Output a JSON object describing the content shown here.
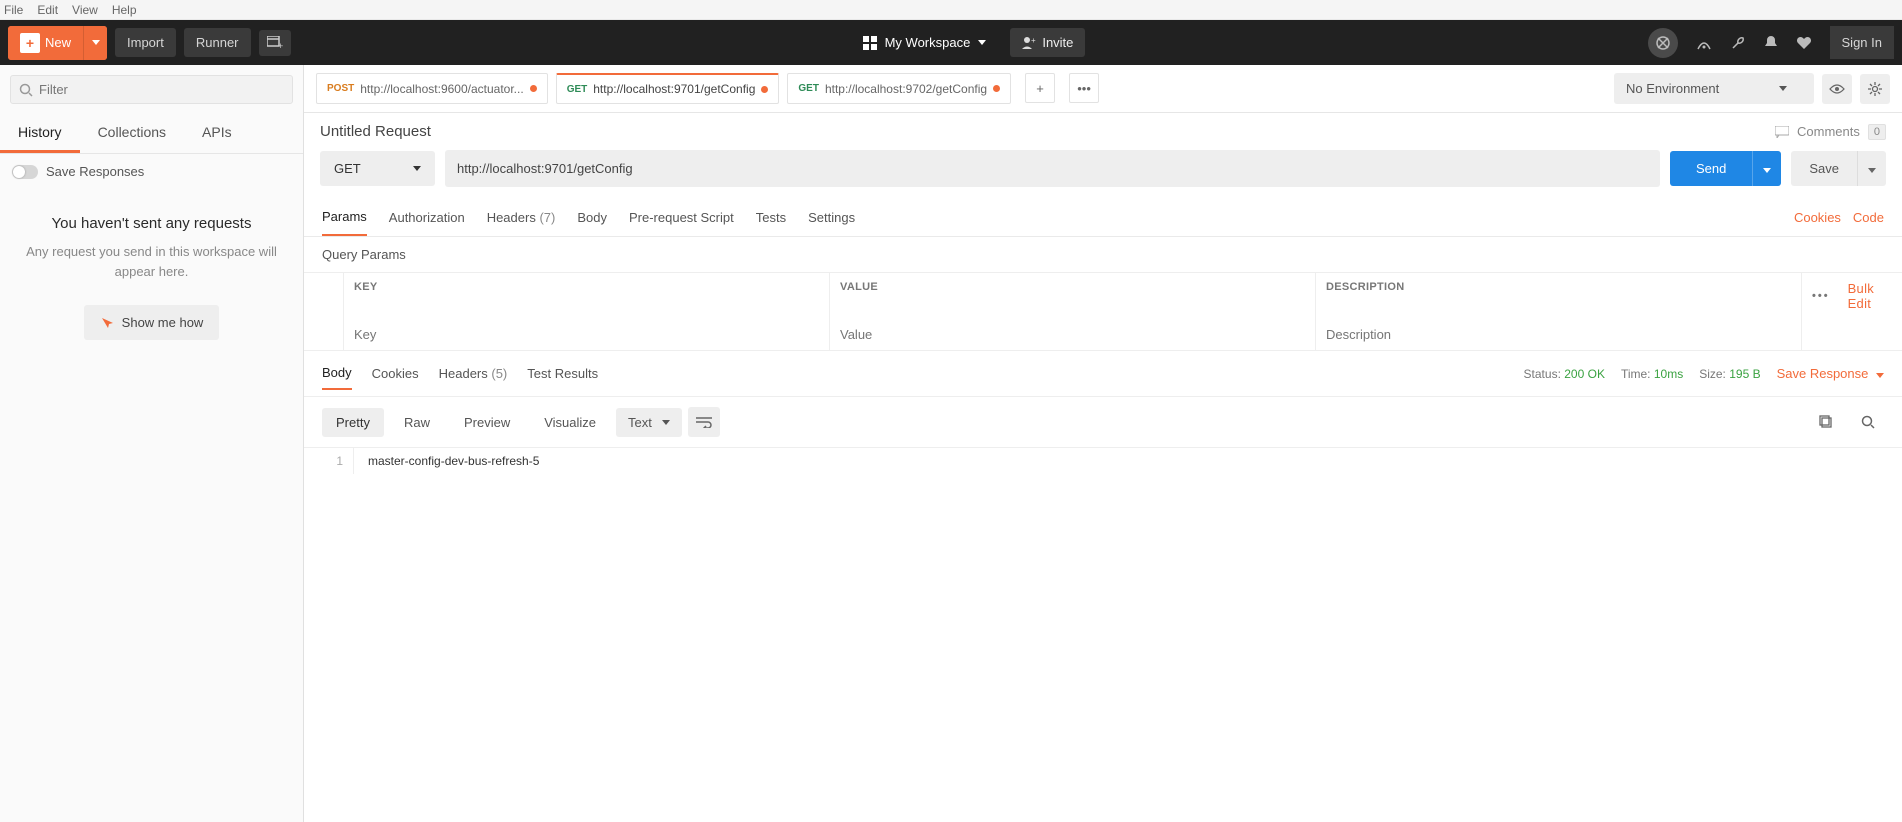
{
  "menu": {
    "file": "File",
    "edit": "Edit",
    "view": "View",
    "help": "Help"
  },
  "toolbar": {
    "new_label": "New",
    "import_label": "Import",
    "runner_label": "Runner",
    "workspace_label": "My Workspace",
    "invite_label": "Invite",
    "signin_label": "Sign In"
  },
  "sidebar": {
    "filter_placeholder": "Filter",
    "tabs": {
      "history": "History",
      "collections": "Collections",
      "apis": "APIs"
    },
    "save_responses": "Save Responses",
    "empty_title": "You haven't sent any requests",
    "empty_sub": "Any request you send in this workspace will appear here.",
    "showme": "Show me how"
  },
  "tabs": [
    {
      "method": "POST",
      "url": "http://localhost:9600/actuator...",
      "dirty": true
    },
    {
      "method": "GET",
      "url": "http://localhost:9701/getConfig",
      "dirty": true
    },
    {
      "method": "GET",
      "url": "http://localhost:9702/getConfig",
      "dirty": true
    }
  ],
  "env": {
    "label": "No Environment"
  },
  "request": {
    "title": "Untitled Request",
    "comments_label": "Comments",
    "comments_count": "0",
    "method": "GET",
    "url": "http://localhost:9701/getConfig",
    "send_label": "Send",
    "save_label": "Save"
  },
  "req_subtabs": {
    "params": "Params",
    "auth": "Authorization",
    "headers": "Headers",
    "headers_count": "(7)",
    "body": "Body",
    "prereq": "Pre-request Script",
    "tests": "Tests",
    "settings": "Settings",
    "cookies_link": "Cookies",
    "code_link": "Code"
  },
  "params_section": {
    "title": "Query Params",
    "col_key": "KEY",
    "col_value": "VALUE",
    "col_desc": "DESCRIPTION",
    "bulk_edit": "Bulk Edit",
    "ph_key": "Key",
    "ph_value": "Value",
    "ph_desc": "Description"
  },
  "response": {
    "tabs": {
      "body": "Body",
      "cookies": "Cookies",
      "headers": "Headers",
      "headers_count": "(5)",
      "tests": "Test Results"
    },
    "status_label": "Status:",
    "status_value": "200 OK",
    "time_label": "Time:",
    "time_value": "10ms",
    "size_label": "Size:",
    "size_value": "195 B",
    "save_response": "Save Response",
    "views": {
      "pretty": "Pretty",
      "raw": "Raw",
      "preview": "Preview",
      "visualize": "Visualize"
    },
    "format": "Text",
    "body_lines": [
      "master-config-dev-bus-refresh-5"
    ]
  },
  "chart_data": null
}
